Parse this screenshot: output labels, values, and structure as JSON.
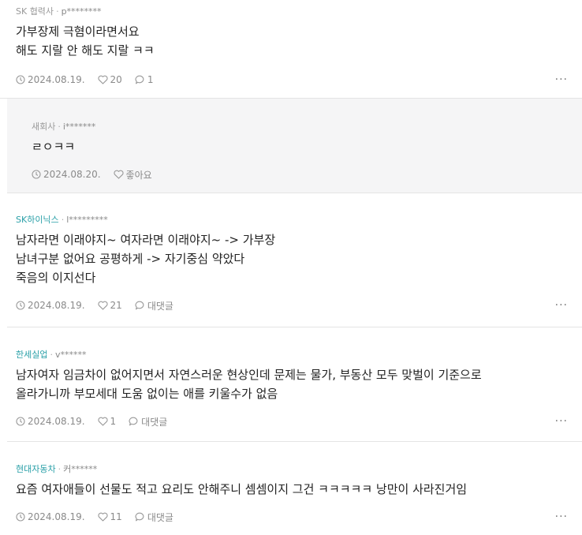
{
  "comments": [
    {
      "company": "SK 협력사",
      "user": "p********",
      "body": "가부장제 극혐이라면서요\n해도 지랄 안 해도 지랄 ㅋㅋ",
      "date": "2024.08.19.",
      "likes": "20",
      "replies": "1"
    },
    {
      "company": "새회사",
      "user": "i*******",
      "body": "ㄹㅇㅋㅋ",
      "date": "2024.08.20.",
      "like_label": "좋아요"
    },
    {
      "company": "SK하이닉스",
      "user": "l*********",
      "body": "남자라면 이래야지~ 여자라면 이래야지~ -> 가부장\n남녀구분 없어요 공평하게 -> 자기중심 약았다\n죽음의 이지선다",
      "date": "2024.08.19.",
      "likes": "21",
      "reply_label": "대댓글"
    },
    {
      "company": "한세실업",
      "user": "v******",
      "body": "남자여자 임금차이 없어지면서 자연스러운 현상인데 문제는 물가, 부동산 모두 맞벌이 기준으로\n올라가니까 부모세대 도움 없이는 애를 키울수가 없음",
      "date": "2024.08.19.",
      "likes": "1",
      "reply_label": "대댓글"
    },
    {
      "company": "현대자동차",
      "user": "커******",
      "body": "요즘 여자애들이 선물도 적고 요리도 안해주니 셈셈이지 그건 ㅋㅋㅋㅋㅋ 낭만이 사라진거임",
      "date": "2024.08.19.",
      "likes": "11",
      "reply_label": "대댓글"
    }
  ],
  "meta_separator": "·",
  "more_label": "···",
  "colors": {
    "company_link": "#2aa0a8",
    "reply_bg": "#f5f5f6",
    "divider": "#e4e4e4"
  }
}
